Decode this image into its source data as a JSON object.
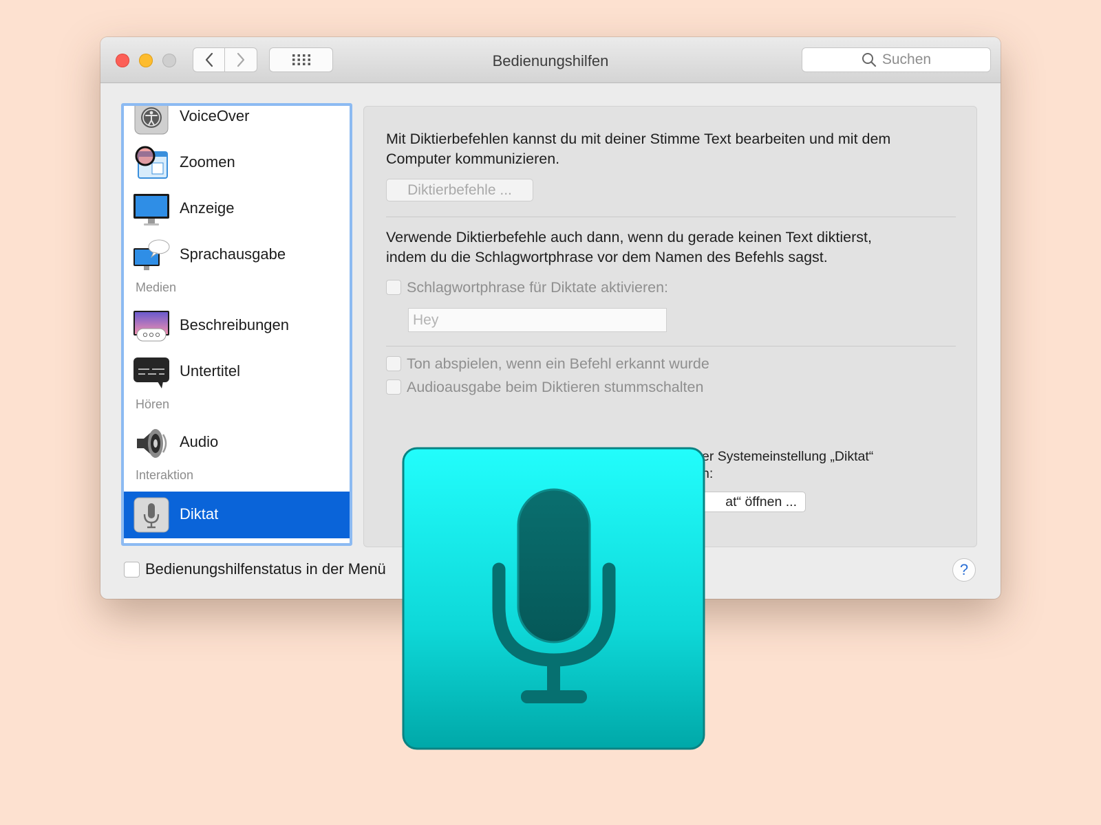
{
  "window": {
    "title": "Bedienungshilfen",
    "search": {
      "placeholder": "Suchen",
      "icon": "magnifier"
    }
  },
  "sidebar": {
    "items": [
      {
        "label": "VoiceOver",
        "icon": "voiceover-icon"
      },
      {
        "label": "Zoomen",
        "icon": "zoom-icon"
      },
      {
        "label": "Anzeige",
        "icon": "display-icon"
      },
      {
        "label": "Sprachausgabe",
        "icon": "speech-icon"
      },
      {
        "label": "Beschreibungen",
        "icon": "descriptions-icon"
      },
      {
        "label": "Untertitel",
        "icon": "captions-icon"
      },
      {
        "label": "Audio",
        "icon": "speaker-icon"
      },
      {
        "label": "Diktat",
        "icon": "microphone-icon",
        "selected": true
      }
    ],
    "headers": {
      "media": "Medien",
      "hearing": "Hören",
      "interaction": "Interaktion"
    }
  },
  "content": {
    "intro_line1": "Mit Diktierbefehlen kannst du mit deiner Stimme Text bearbeiten und mit dem",
    "intro_line2": "Computer kommunizieren.",
    "dictation_commands_button": "Diktierbefehle ...",
    "keyword_text_line1": "Verwende Diktierbefehle auch dann, wenn du gerade keinen Text diktierst,",
    "keyword_text_line2": "indem du die Schlagwortphrase vor dem Namen des Befehls sagst.",
    "keyword_checkbox": "Schlagwortphrase für Diktate aktivieren:",
    "keyword_field": {
      "value": "Hey"
    },
    "play_sound_checkbox": "Ton abspielen, wenn ein Befehl erkannt wurde",
    "mute_audio_checkbox": "Audioausgabe beim Diktieren stummschalten",
    "system_pref_line1": "er Systemeinstellung „Diktat“",
    "system_pref_line2": "n:",
    "system_pref_button": "at“ öffnen ..."
  },
  "footer": {
    "menu_status_checkbox": "Bedienungshilfenstatus in der Menü",
    "help": "?"
  },
  "colors": {
    "background": "#fde1d0",
    "selection": "#0a64d9",
    "sidebar_focus": "#8cbaf2",
    "mic_tile_top": "#1ffcfb",
    "mic_tile_bottom": "#00a9a9",
    "mic_glyph": "#065e5e"
  }
}
